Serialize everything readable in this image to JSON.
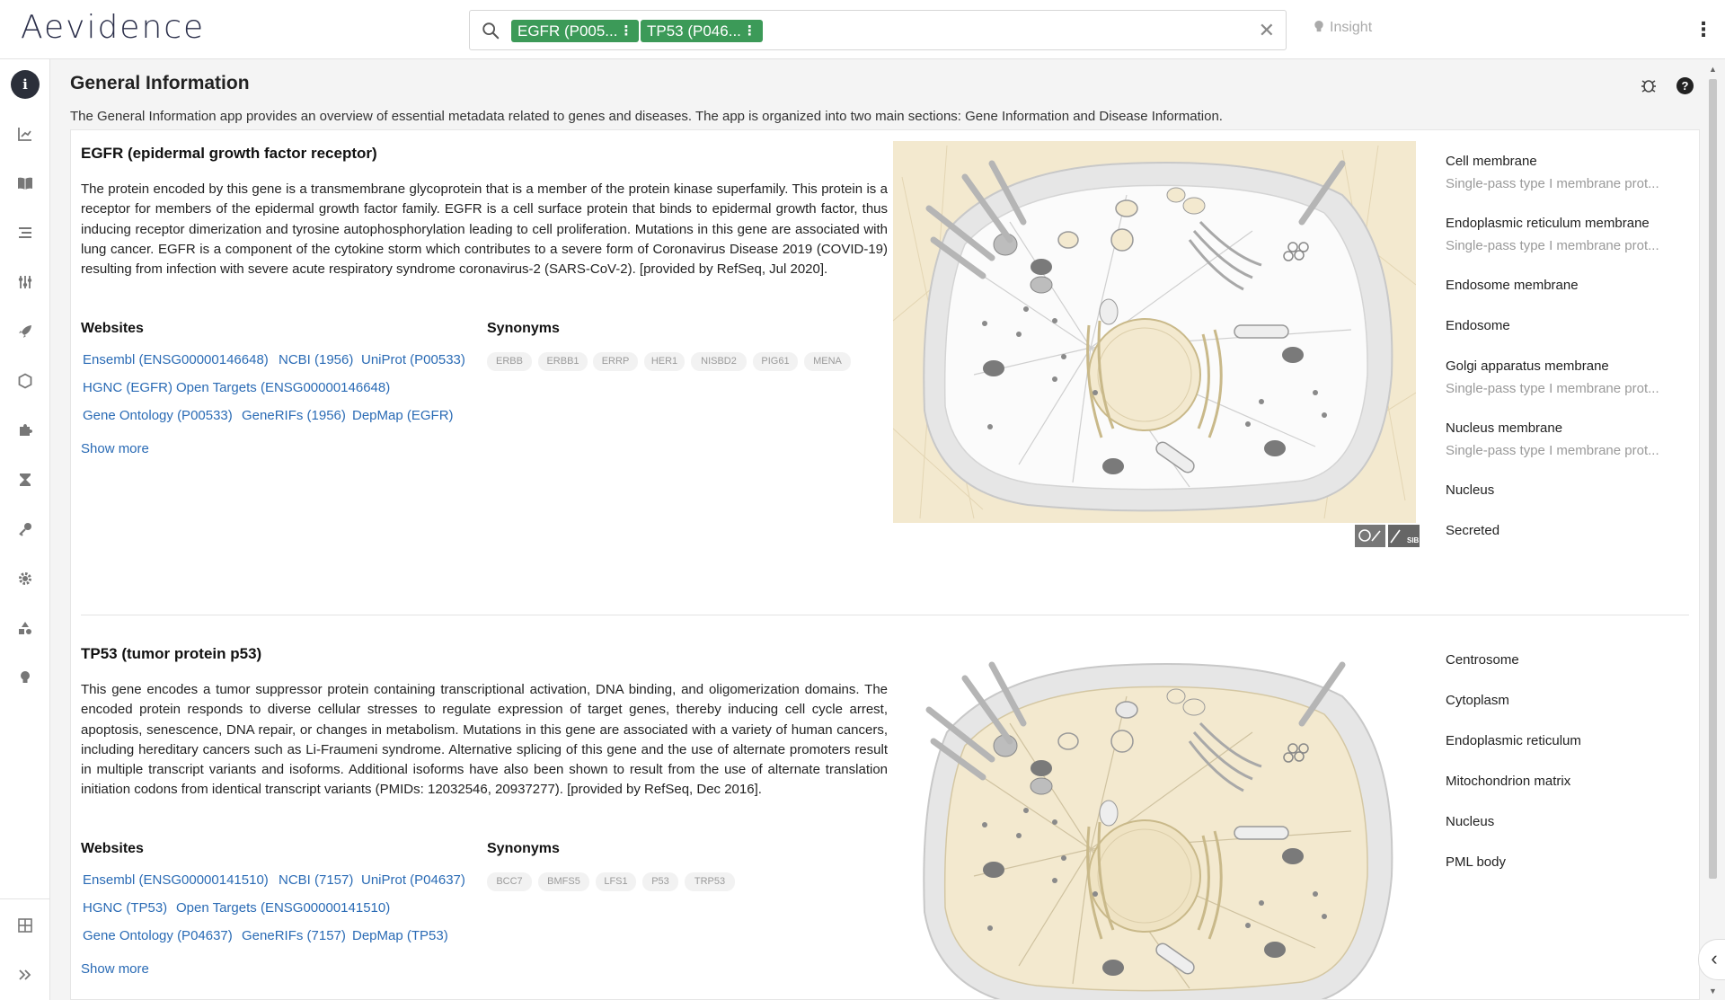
{
  "app": {
    "logo": "Aevidence"
  },
  "search": {
    "chips": [
      {
        "label": "EGFR (P005..."
      },
      {
        "label": "TP53 (P046..."
      }
    ],
    "insight_label": "Insight"
  },
  "header": {
    "title": "General Information",
    "description": "The General Information app provides an overview of essential metadata related to genes and diseases. The app is organized into two main sections: Gene Information and Disease Information."
  },
  "genes": [
    {
      "title": "EGFR (epidermal growth factor receptor)",
      "description": "The protein encoded by this gene is a transmembrane glycoprotein that is a member of the protein kinase superfamily. This protein is a receptor for members of the epidermal growth factor family. EGFR is a cell surface protein that binds to epidermal growth factor, thus inducing receptor dimerization and tyrosine autophosphorylation leading to cell proliferation. Mutations in this gene are associated with lung cancer. EGFR is a component of the cytokine storm which contributes to a severe form of Coronavirus Disease 2019 (COVID-19) resulting from infection with severe acute respiratory syndrome coronavirus-2 (SARS-CoV-2). [provided by RefSeq, Jul 2020].",
      "websites_label": "Websites",
      "synonyms_label": "Synonyms",
      "links": [
        "Ensembl (ENSG00000146648)",
        "NCBI (1956)",
        "UniProt (P00533)",
        "HGNC (EGFR)",
        "Open Targets (ENSG00000146648)",
        "Gene Ontology (P00533)",
        "GeneRIFs (1956)",
        "DepMap (EGFR)"
      ],
      "show_more": "Show more",
      "synonyms": [
        "ERBB",
        "ERBB1",
        "ERRP",
        "HER1",
        "NISBD2",
        "PIG61",
        "MENA"
      ],
      "locations": [
        {
          "name": "Cell membrane",
          "sub": "Single-pass type I membrane prot..."
        },
        {
          "name": "Endoplasmic reticulum membrane",
          "sub": "Single-pass type I membrane prot..."
        },
        {
          "name": "Endosome membrane",
          "sub": ""
        },
        {
          "name": "Endosome",
          "sub": ""
        },
        {
          "name": "Golgi apparatus membrane",
          "sub": "Single-pass type I membrane prot..."
        },
        {
          "name": "Nucleus membrane",
          "sub": "Single-pass type I membrane prot..."
        },
        {
          "name": "Nucleus",
          "sub": ""
        },
        {
          "name": "Secreted",
          "sub": ""
        }
      ],
      "attribution": "SIB"
    },
    {
      "title": "TP53 (tumor protein p53)",
      "description": "This gene encodes a tumor suppressor protein containing transcriptional activation, DNA binding, and oligomerization domains. The encoded protein responds to diverse cellular stresses to regulate expression of target genes, thereby inducing cell cycle arrest, apoptosis, senescence, DNA repair, or changes in metabolism. Mutations in this gene are associated with a variety of human cancers, including hereditary cancers such as Li-Fraumeni syndrome. Alternative splicing of this gene and the use of alternate promoters result in multiple transcript variants and isoforms. Additional isoforms have also been shown to result from the use of alternate translation initiation codons from identical transcript variants (PMIDs: 12032546, 20937277). [provided by RefSeq, Dec 2016].",
      "websites_label": "Websites",
      "synonyms_label": "Synonyms",
      "links": [
        "Ensembl (ENSG00000141510)",
        "NCBI (7157)",
        "UniProt (P04637)",
        "HGNC (TP53)",
        "Open Targets (ENSG00000141510)",
        "Gene Ontology (P04637)",
        "GeneRIFs (7157)",
        "DepMap (TP53)"
      ],
      "show_more": "Show more",
      "synonyms": [
        "BCC7",
        "BMFS5",
        "LFS1",
        "P53",
        "TRP53"
      ],
      "locations": [
        {
          "name": "Centrosome",
          "sub": ""
        },
        {
          "name": "Cytoplasm",
          "sub": ""
        },
        {
          "name": "Endoplasmic reticulum",
          "sub": ""
        },
        {
          "name": "Mitochondrion matrix",
          "sub": ""
        },
        {
          "name": "Nucleus",
          "sub": ""
        },
        {
          "name": "PML body",
          "sub": ""
        }
      ]
    }
  ],
  "colors": {
    "chip": "#3c9a58",
    "link": "#2a6bb5",
    "cell_highlight": "#f3e9cf",
    "cell_base": "#e6e6e6"
  },
  "sidebar_icons": [
    "info-icon",
    "chart-icon",
    "book-icon",
    "list-icon",
    "sliders-icon",
    "rocket-icon",
    "hexagon-icon",
    "puzzle-icon",
    "hourglass-icon",
    "key-icon",
    "gear-icon",
    "shapes-icon",
    "bulb-icon",
    "grid-icon",
    "expand-icon"
  ]
}
